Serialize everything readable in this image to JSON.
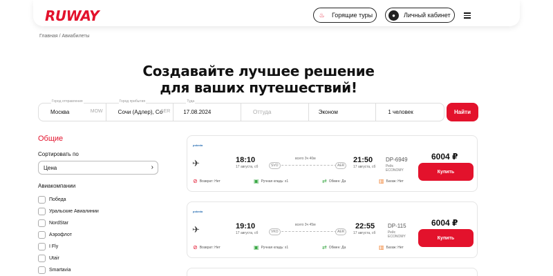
{
  "header": {
    "logo": "RUWAY",
    "hot_tours": "Горящие туры",
    "cabinet": "Личный кабинет"
  },
  "breadcrumb": "Главная / Авиабилеты",
  "hero": {
    "line1": "Создавайте лучшее решение",
    "line2": "для ваших путешествий!"
  },
  "search": {
    "from_label": "Город отправления",
    "from_value": "Москва",
    "from_code": "MOW",
    "to_label": "Город прибытия",
    "to_value": "Сочи (Адлер), Сочи",
    "to_code": "AER",
    "there_label": "Туда",
    "there_value": "17.08.2024",
    "back_placeholder": "Оттуда",
    "class_value": "Эконом",
    "passengers_value": "1 человек",
    "find_button": "Найти"
  },
  "filters": {
    "title": "Общие",
    "sort_label": "Сортировать по",
    "sort_value": "Цена",
    "airlines_label": "Авиакомпании",
    "airlines": [
      "Победа",
      "Уральские Авиалинии",
      "NordStar",
      "Аэрофлот",
      "I Fly",
      "Utair",
      "Smartavia"
    ]
  },
  "flights": [
    {
      "airline_logo": "pobeda",
      "dep_time": "18:10",
      "dep_date": "17 августа, сб",
      "dep_airport": "SVO",
      "duration": "всего 3ч 40м",
      "arr_airport": "AER",
      "arr_time": "21:50",
      "arr_date": "17 августа, сб",
      "flight_no": "DP-6949",
      "flight_word": "Рейс",
      "class": "ECONOMY",
      "price": "6004 ₽",
      "buy": "Купить",
      "refund": "Возврат: Нет",
      "carryon": "Ручная кладь: x1",
      "exchange": "Обмен: Да",
      "baggage": "Багаж: Нет"
    },
    {
      "airline_logo": "pobeda",
      "dep_time": "19:10",
      "dep_date": "17 августа, сб",
      "dep_airport": "VKO",
      "duration": "всего 3ч 45м",
      "arr_airport": "AER",
      "arr_time": "22:55",
      "arr_date": "17 августа, сб",
      "flight_no": "DP-115",
      "flight_word": "Рейс",
      "class": "ECONOMY",
      "price": "6004 ₽",
      "buy": "Купить",
      "refund": "Возврат: Нет",
      "carryon": "Ручная кладь: x1",
      "exchange": "Обмен: Да",
      "baggage": "Багаж: Нет"
    }
  ],
  "colors": {
    "brand": "#e3122c",
    "accent_green": "#3aa845",
    "accent_orange": "#f07c2a"
  },
  "icons": {
    "hot": "flame-icon",
    "cabinet": "user-icon",
    "menu": "hamburger-icon",
    "plane": "plane-icon"
  }
}
